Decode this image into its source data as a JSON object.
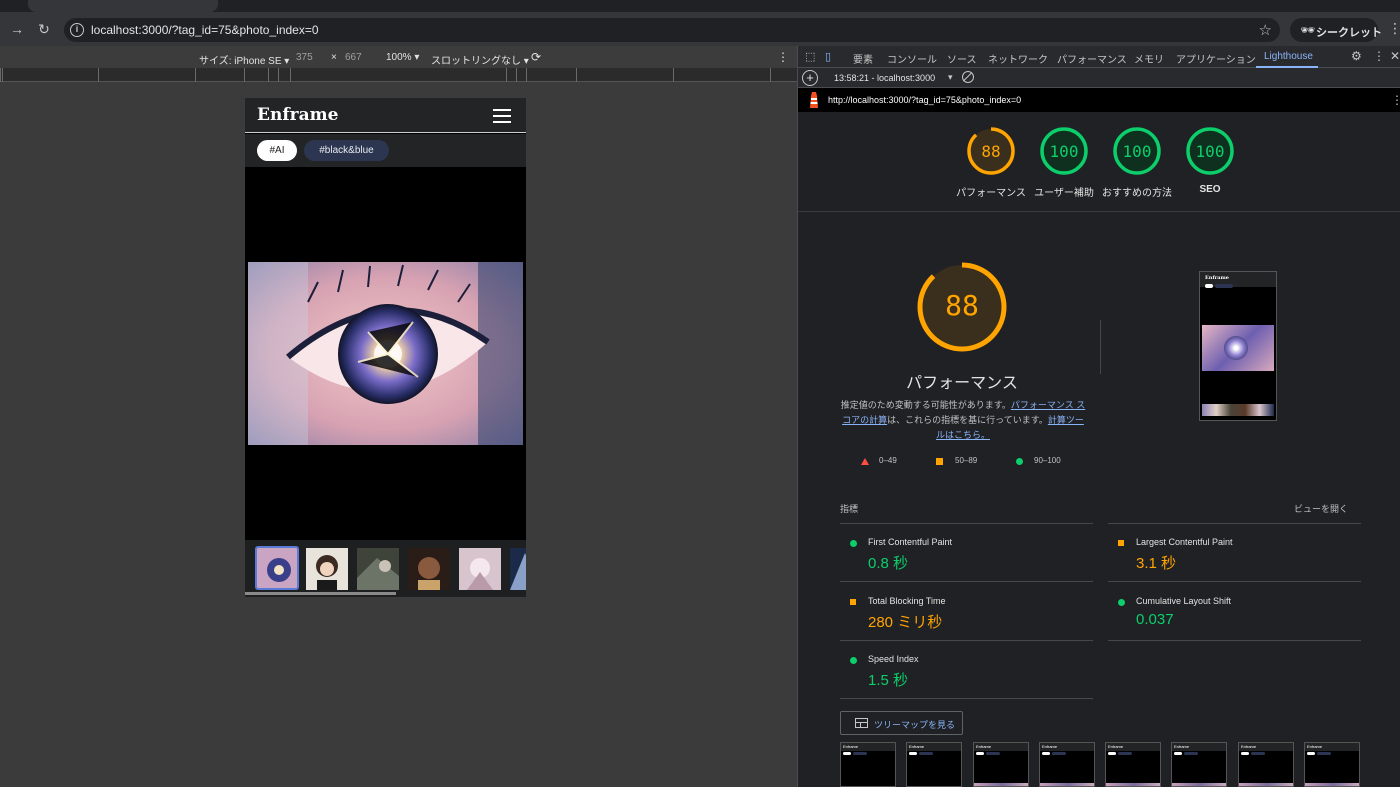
{
  "browser": {
    "url": "localhost:3000/?tag_id=75&photo_index=0",
    "incognito_label": "シークレット",
    "icons": [
      "back-icon",
      "reload-icon",
      "site-info-icon",
      "bookmark-star-icon",
      "incognito-icon",
      "more-icon"
    ]
  },
  "device_toolbar": {
    "device": "サイズ: iPhone SE ▾",
    "width": "375",
    "times": "×",
    "height": "667",
    "zoom": "100% ▾",
    "throttling": "スロットリングなし ▾"
  },
  "app": {
    "logo": "Enframe",
    "tags": [
      "#AI",
      "#black&blue"
    ]
  },
  "devtools": {
    "tabs": [
      "要素",
      "コンソール",
      "ソース",
      "ネットワーク",
      "パフォーマンス",
      "メモリ",
      "アプリケーション",
      "Lighthouse"
    ],
    "report_selector": "13:58:21 - localhost:3000",
    "report_url": "http://localhost:3000/?tag_id=75&photo_index=0"
  },
  "lighthouse": {
    "summary": [
      {
        "score": "88",
        "label": "パフォーマンス",
        "color": "#ffa400"
      },
      {
        "score": "100",
        "label": "ユーザー補助",
        "color": "#0cce6b"
      },
      {
        "score": "100",
        "label": "おすすめの方法",
        "color": "#0cce6b"
      },
      {
        "score": "100",
        "label": "SEO",
        "color": "#0cce6b"
      }
    ],
    "main_score": "88",
    "main_title": "パフォーマンス",
    "desc_prefix": "推定値のため変動する可能性があります。",
    "desc_link1": "パフォーマンス スコアの計算",
    "desc_mid": "は、これらの指標を基に行っています。",
    "desc_link2": "計算ツールはこちら。",
    "legend": [
      "0–49",
      "50–89",
      "90–100"
    ],
    "metrics_header": "指標",
    "expand_view": "ビューを開く",
    "metrics": [
      {
        "name": "First Contentful Paint",
        "value": "0.8 秒",
        "status": "good"
      },
      {
        "name": "Largest Contentful Paint",
        "value": "3.1 秒",
        "status": "average"
      },
      {
        "name": "Total Blocking Time",
        "value": "280 ミリ秒",
        "status": "average"
      },
      {
        "name": "Cumulative Layout Shift",
        "value": "0.037",
        "status": "good"
      },
      {
        "name": "Speed Index",
        "value": "1.5 秒",
        "status": "good"
      }
    ],
    "treemap_button": "ツリーマップを見る",
    "filmstrip_label": "Enframe"
  },
  "colors": {
    "good": "#0cce6b",
    "average": "#ffa400",
    "poor": "#ff4e42",
    "link": "#8ab4f8"
  }
}
